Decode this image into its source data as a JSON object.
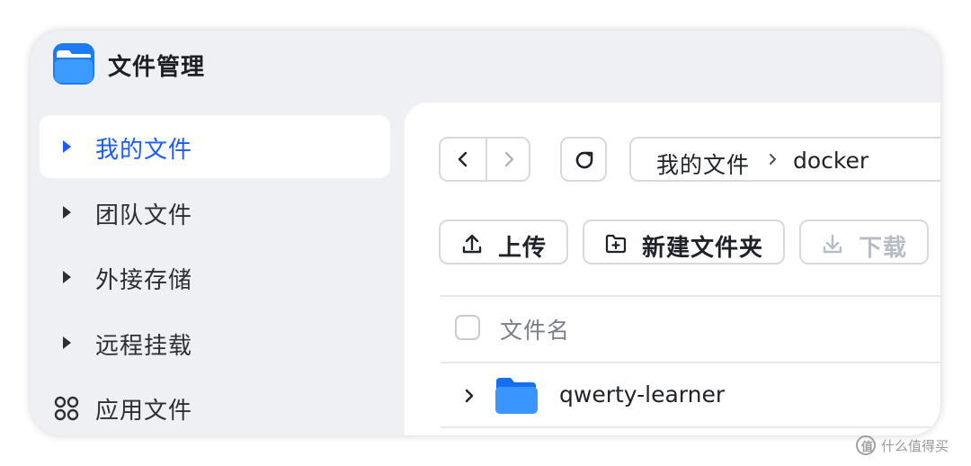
{
  "app": {
    "title": "文件管理",
    "accent": "#1a5cff"
  },
  "sidebar": {
    "items": [
      {
        "label": "我的文件",
        "icon": "caret-right-icon",
        "active": true
      },
      {
        "label": "团队文件",
        "icon": "caret-right-icon",
        "active": false
      },
      {
        "label": "外接存储",
        "icon": "caret-right-icon",
        "active": false
      },
      {
        "label": "远程挂载",
        "icon": "caret-right-icon",
        "active": false
      },
      {
        "label": "应用文件",
        "icon": "apps-grid-icon",
        "active": false
      }
    ]
  },
  "breadcrumb": {
    "root": "我的文件",
    "separator_icon": "chevron-right-icon",
    "current": "docker"
  },
  "toolbar": {
    "upload_label": "上传",
    "new_folder_label": "新建文件夹",
    "download_label": "下载"
  },
  "file_list": {
    "column_header": "文件名",
    "rows": [
      {
        "name": "qwerty-learner",
        "type": "folder"
      }
    ]
  },
  "watermark": {
    "text": "什么值得买",
    "logo_text": "值"
  }
}
